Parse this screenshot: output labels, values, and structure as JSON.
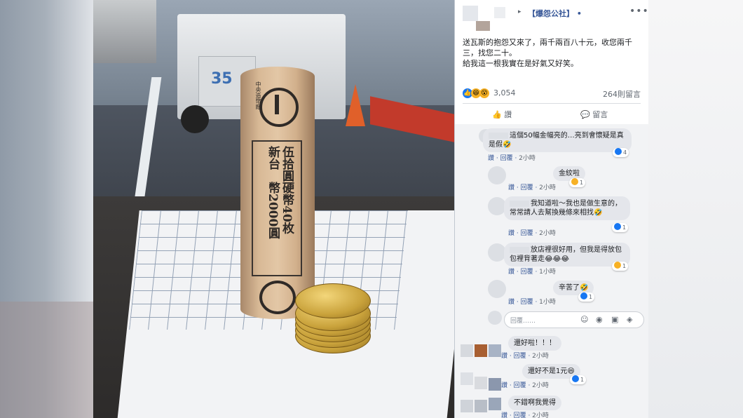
{
  "post": {
    "group_name": "【爆怨公社】",
    "separator_left": "▸",
    "separator_right": "•",
    "more_icon": "•••",
    "text_line1": "送瓦斯的抱怨又來了，兩千兩百八十元，收您兩千三，找您二十。",
    "text_line2": "給我這一根我實在是好氣又好笑。",
    "reaction_count": "3,054",
    "comment_count": "264則留言",
    "like_label": "讚",
    "comment_label": "留言"
  },
  "photo": {
    "roll_line1": "新台　幣2000圓",
    "roll_line2": "伍拾圓硬幣40枚",
    "roll_small": "中央造幣廠",
    "truck_number": "35"
  },
  "comments": [
    {
      "text": "這個50幅金幅亮的…亮到會懷疑是真是假🤣",
      "reaction": "4",
      "actions": "讚 · 回覆 · ",
      "time": "2小時"
    },
    {
      "text": "金紋啦",
      "reaction": "1",
      "actions": "讚 · 回覆 · ",
      "time": "2小時"
    },
    {
      "text": "我知道啦～我也是做生意的，常常請人去幫換幾條來相找🤣",
      "reaction": "1",
      "actions": "讚 · 回覆 · ",
      "time": "2小時"
    },
    {
      "text": "放店裡很好用，但我是得放包包裡背著走😂😂😂",
      "reaction": "1",
      "actions": "讚 · 回覆 · ",
      "time": "1小時"
    },
    {
      "text": "辛苦了🤣",
      "reaction": "1",
      "actions": "讚 · 回覆 · ",
      "time": "1小時"
    },
    {
      "text": "還好啦！！！",
      "reaction": "",
      "actions": "讚 · 回覆 · ",
      "time": "2小時"
    },
    {
      "text": "還好不是1元😆",
      "reaction": "1",
      "actions": "讚 · 回覆 · ",
      "time": "2小時"
    },
    {
      "text": "不錯啊我覺得",
      "reaction": "",
      "actions": "讚 · 回覆 · ",
      "time": "2小時"
    }
  ],
  "reply": {
    "placeholder": "回覆……"
  },
  "colors": {
    "link": "#385898",
    "like": "#1877f2",
    "haha": "#f7b125"
  }
}
